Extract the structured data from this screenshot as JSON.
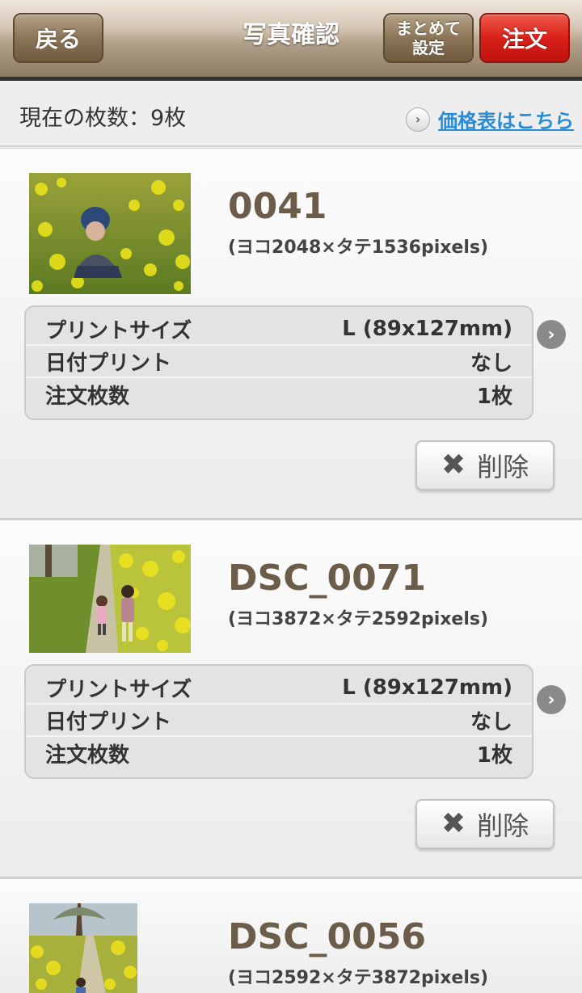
{
  "header": {
    "back_label": "戻る",
    "title": "写真確認",
    "bulk_label": "まとめて\n設定",
    "order_label": "注文"
  },
  "info": {
    "count_text": "現在の枚数：9枚",
    "price_link": "価格表はこちら"
  },
  "spec_labels": {
    "print_size": "プリントサイズ",
    "date_print": "日付プリント",
    "order_qty": "注文枚数"
  },
  "delete_label": "削除",
  "photos": [
    {
      "name": "0041",
      "dims": "(ヨコ2048×タテ1536pixels)",
      "print_size": "L (89x127mm)",
      "date_print": "なし",
      "qty": "1枚",
      "thumb_icon": "photo-child-in-flowers"
    },
    {
      "name": "DSC_0071",
      "dims": "(ヨコ3872×タテ2592pixels)",
      "print_size": "L (89x127mm)",
      "date_print": "なし",
      "qty": "1枚",
      "thumb_icon": "photo-children-on-path"
    },
    {
      "name": "DSC_0056",
      "dims": "(ヨコ2592×タテ3872pixels)",
      "thumb_icon": "photo-path-with-tree"
    }
  ],
  "colors": {
    "header_brown": "#8b7557",
    "order_red": "#d8201a",
    "link_blue": "#2a8bd6",
    "filename": "#6b5d49"
  }
}
